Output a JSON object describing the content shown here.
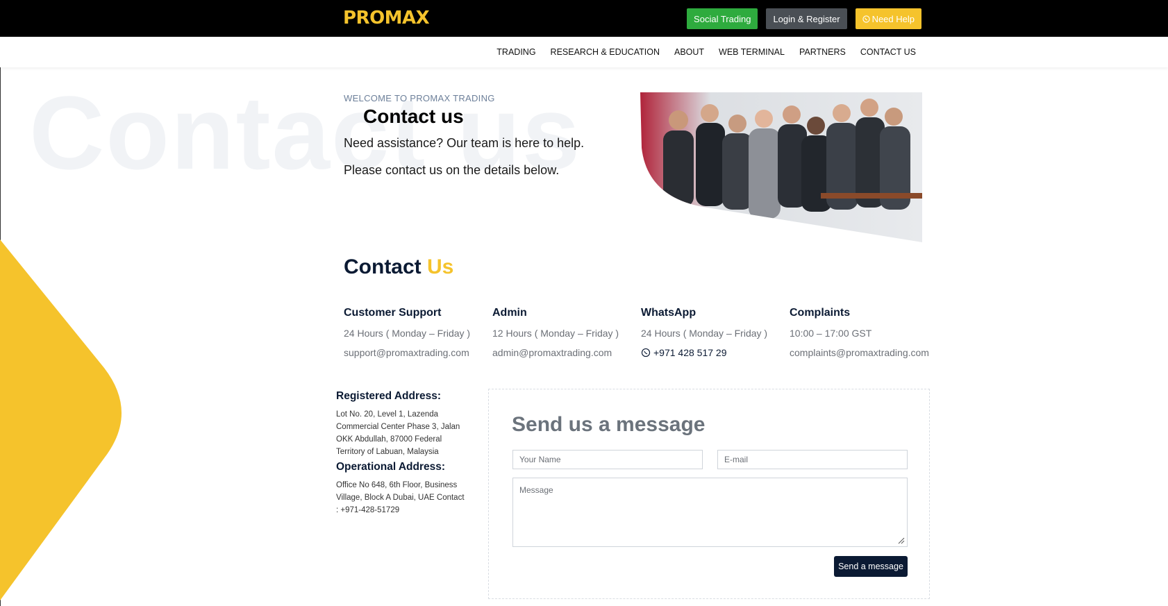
{
  "header": {
    "logo_text": "PROMAX",
    "buttons": {
      "social_trading": "Social Trading",
      "login_register": "Login & Register",
      "need_help": "Need Help"
    }
  },
  "nav": {
    "items": [
      "TRADING",
      "RESEARCH & EDUCATION",
      "ABOUT",
      "WEB TERMINAL",
      "PARTNERS",
      "CONTACT US"
    ]
  },
  "hero": {
    "watermark": "Contact us",
    "eyebrow": "WELCOME TO PROMAX TRADING",
    "title": "Contact us",
    "line1": "Need assistance? Our team is here to help.",
    "line2": "Please contact us on the details below."
  },
  "contact": {
    "heading_main": "Contact",
    "heading_accent": "Us",
    "channels": [
      {
        "title": "Customer Support",
        "hours": "24 Hours ( Monday – Friday )",
        "contact": "support@promaxtrading.com"
      },
      {
        "title": "Admin",
        "hours": "12 Hours ( Monday – Friday )",
        "contact": "admin@promaxtrading.com"
      },
      {
        "title": "WhatsApp",
        "hours": "24 Hours ( Monday – Friday )",
        "contact": "+971 428 517 29"
      },
      {
        "title": "Complaints",
        "hours": "10:00 – 17:00 GST",
        "contact": "complaints@promaxtrading.com"
      }
    ]
  },
  "address": {
    "registered_title": "Registered Address:",
    "registered_text": "Lot No. 20, Level 1, Lazenda Commercial Center Phase 3, Jalan OKK Abdullah, 87000 Federal Territory of Labuan, Malaysia",
    "operational_title": "Operational Address:",
    "operational_text": "Office No 648, 6th Floor, Business Village, Block A Dubai, UAE Contact : +971-428-51729"
  },
  "form": {
    "title": "Send us a message",
    "name_placeholder": "Your Name",
    "email_placeholder": "E-mail",
    "message_placeholder": "Message",
    "submit_label": "Send a message"
  },
  "colors": {
    "accent": "#f5c32c",
    "navy": "#0b1a33",
    "green": "#2eab3e"
  }
}
